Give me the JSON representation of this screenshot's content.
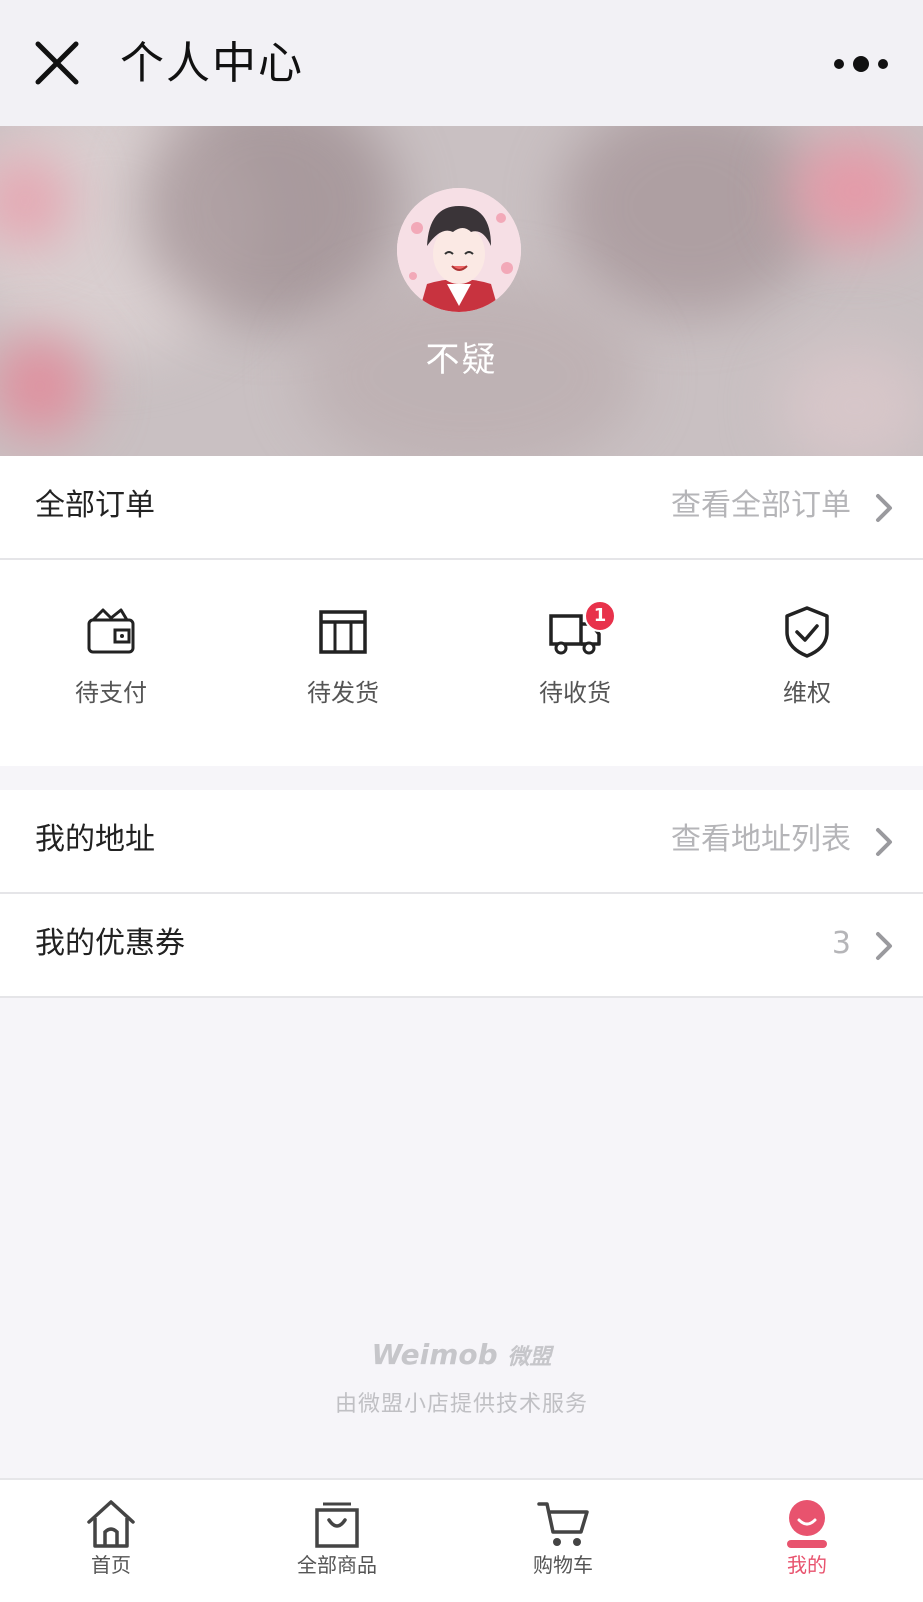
{
  "topbar": {
    "title": "个人中心"
  },
  "profile": {
    "nickname": "不疑"
  },
  "orders": {
    "label": "全部订单",
    "link": "查看全部订单"
  },
  "statuses": [
    {
      "label": "待支付",
      "icon": "wallet-icon"
    },
    {
      "label": "待发货",
      "icon": "package-icon"
    },
    {
      "label": "待收货",
      "icon": "truck-icon",
      "badge": "1"
    },
    {
      "label": "维权",
      "icon": "shield-check-icon"
    }
  ],
  "address": {
    "label": "我的地址",
    "link": "查看地址列表"
  },
  "coupons": {
    "label": "我的优惠券",
    "count": "3"
  },
  "footer": {
    "brand_en": "Weimob",
    "brand_cn": "微盟",
    "powered_by": "由微盟小店提供技术服务"
  },
  "tabs": [
    {
      "label": "首页",
      "icon": "home-icon"
    },
    {
      "label": "全部商品",
      "icon": "shopping-bag-icon"
    },
    {
      "label": "购物车",
      "icon": "cart-icon"
    },
    {
      "label": "我的",
      "icon": "user-icon",
      "active": true
    }
  ],
  "colors": {
    "accent": "#e8536e",
    "badge": "#e8324b",
    "muted_text": "#b5b5b8"
  }
}
